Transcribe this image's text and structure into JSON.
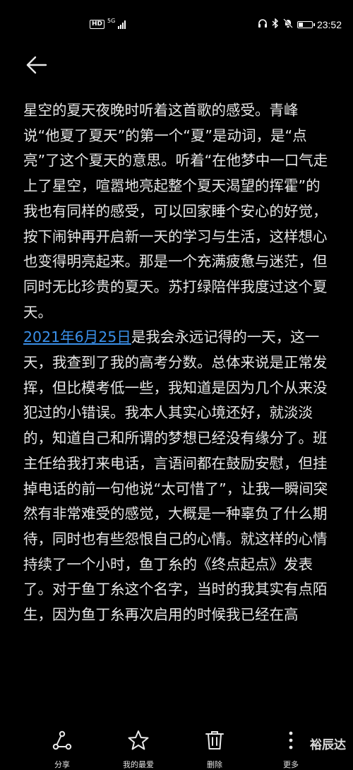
{
  "status_bar": {
    "hd_label": "HD",
    "network_label": "5G",
    "time": "23:52",
    "battery_level": 0.35
  },
  "article": {
    "para1": "星空的夏天夜晚时听着这首歌的感受。青峰说“他夏了夏天”的第一个“夏”是动词，是“点亮”了这个夏天的意思。听着“在他梦中一口气走上了星空，喧嚣地亮起整个夏天渴望的挥霍”的我也有同样的感受，可以回家睡个安心的好觉，按下闹钟再开启新一天的学习与生活，这样想心也变得明亮起来。那是一个充满疲惫与迷茫，但同时无比珍贵的夏天。苏打绿陪伴我度过这个夏天。",
    "date_link": "2021年6月25日",
    "para2_rest": "是我会永远记得的一天，这一天，我查到了我的高考分数。总体来说是正常发挥，但比模考低一些，我知道是因为几个从来没犯过的小错误。我本人其实心境还好，就淡淡的，知道自己和所谓的梦想已经没有缘分了。班主任给我打来电话，言语间都在鼓励安慰，但挂掉电话的前一句他说“太可惜了”，让我一瞬间突然有非常难受的感觉，大概是一种辜负了什么期待，同时也有些怨恨自己的心情。就这样的心情持续了一个小时，鱼丁糸的《终点起点》发表了。对于鱼丁糸这个名字，当时的我其实有点陌生，因为鱼丁糸再次启用的时候我已经在高"
  },
  "toolbar": {
    "share_label": "分享",
    "favorite_label": "我的最爱",
    "delete_label": "删除",
    "more_label": "更多"
  },
  "watermark": "裕辰达",
  "icons": {
    "back": "arrow-left-icon",
    "share": "share-icon",
    "favorite": "star-icon",
    "delete": "trash-icon",
    "more": "more-vertical-icon"
  }
}
